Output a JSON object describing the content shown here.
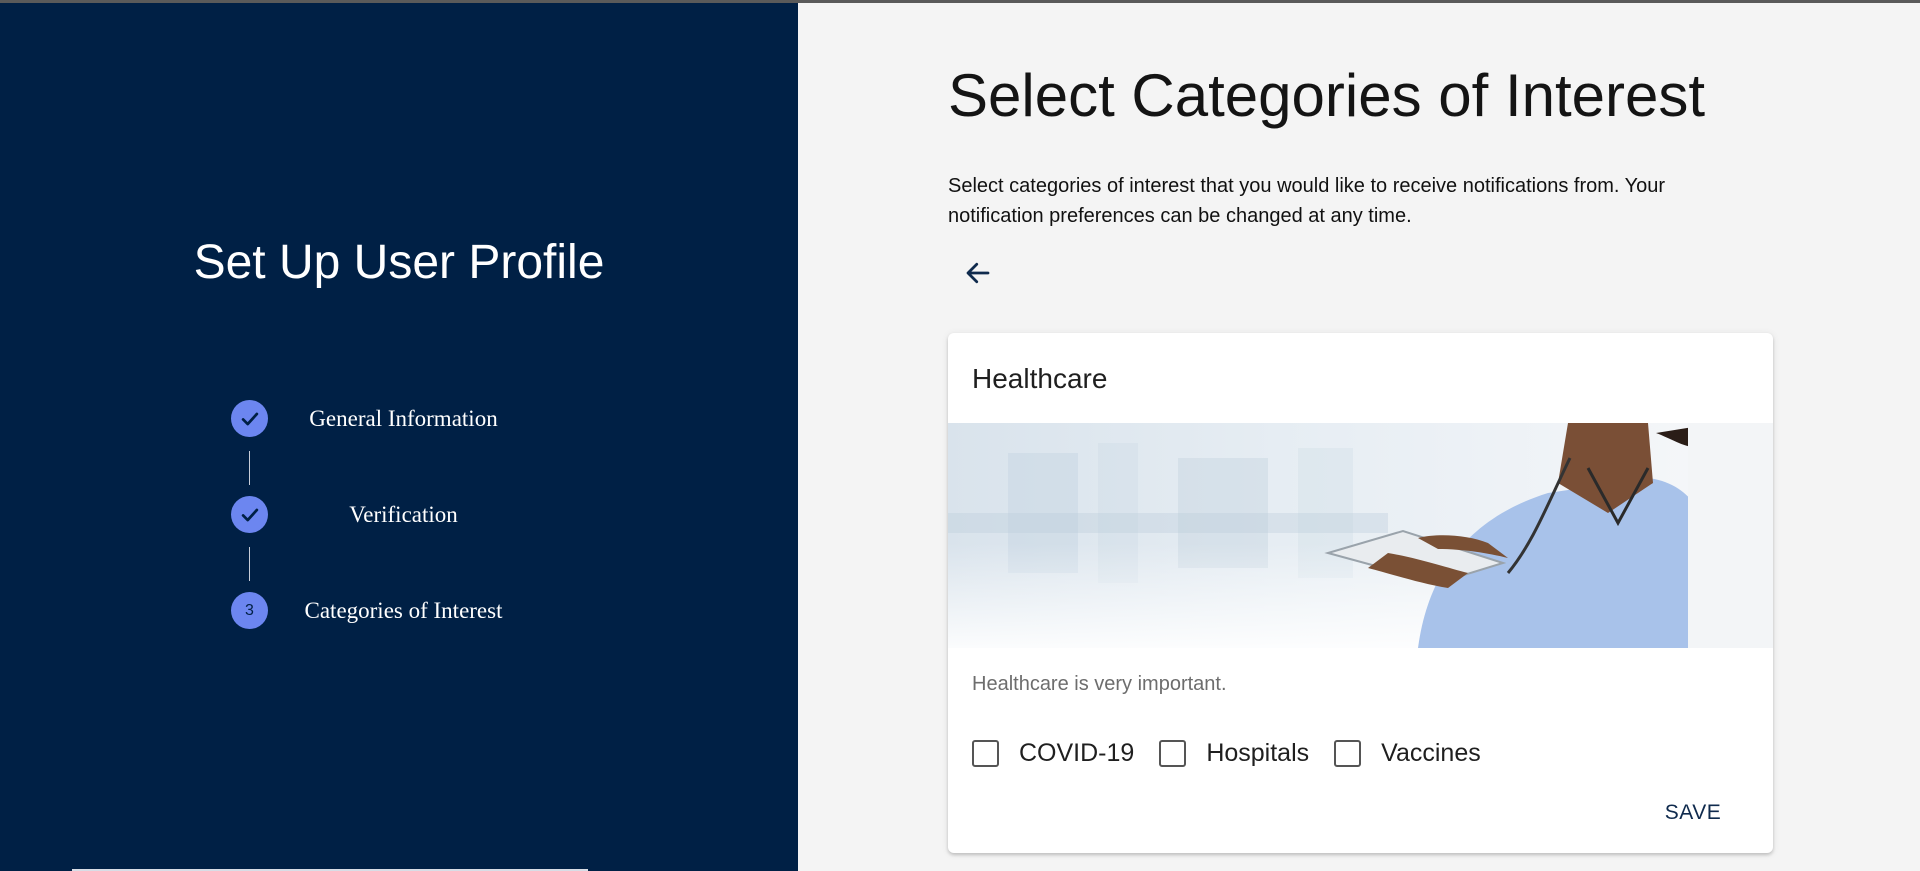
{
  "sidebar": {
    "title": "Set Up User Profile",
    "steps": [
      {
        "label": "General Information",
        "status": "complete",
        "icon": "check-icon"
      },
      {
        "label": "Verification",
        "status": "complete",
        "icon": "check-icon"
      },
      {
        "label": "Categories of Interest",
        "status": "active",
        "number": "3"
      }
    ]
  },
  "main": {
    "title": "Select Categories of Interest",
    "description": "Select categories of interest that you would like to receive notifications from. Your notification preferences can be changed at any time.",
    "back_icon": "arrow-left-icon"
  },
  "card": {
    "title": "Healthcare",
    "image": "healthcare-worker-with-tablet",
    "description": "Healthcare is very important.",
    "options": [
      {
        "label": "COVID-19",
        "checked": false
      },
      {
        "label": "Hospitals",
        "checked": false
      },
      {
        "label": "Vaccines",
        "checked": false
      }
    ],
    "save_label": "SAVE"
  },
  "colors": {
    "sidebar_bg": "#002045",
    "step_accent": "#6c86f0",
    "page_bg": "#f4f4f4"
  }
}
